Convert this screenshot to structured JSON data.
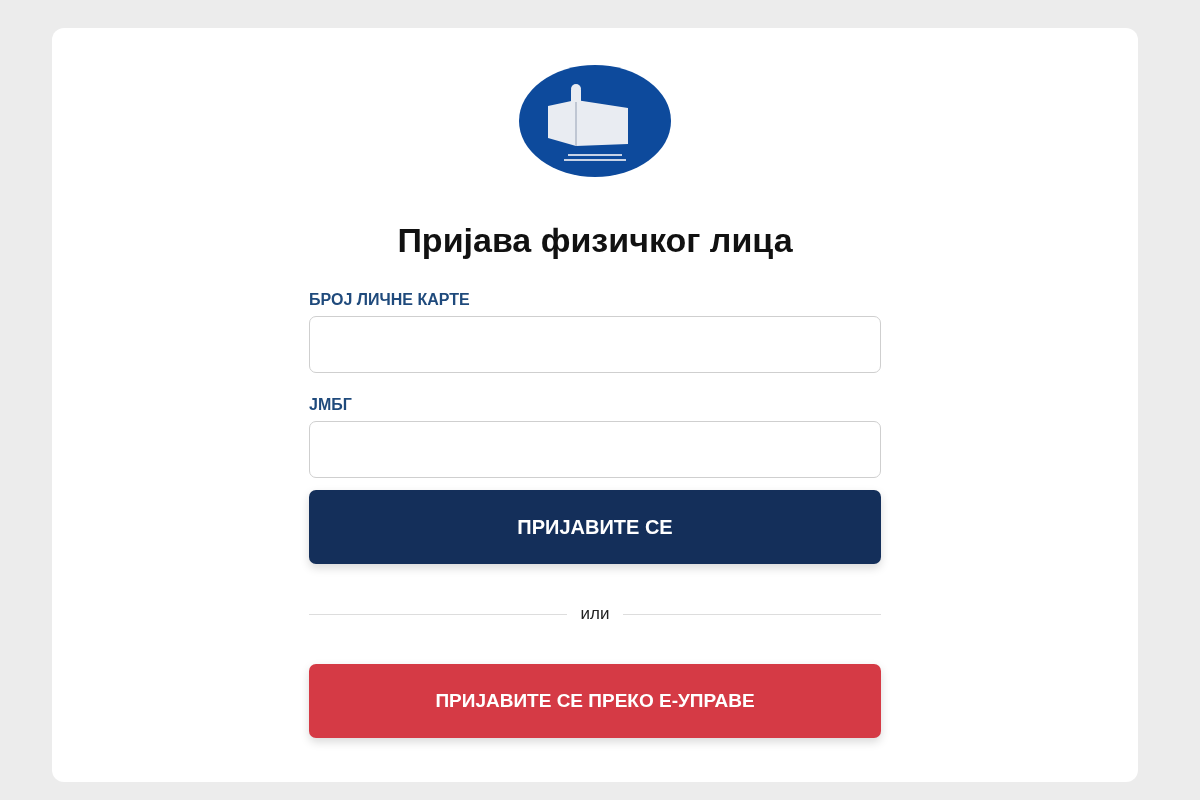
{
  "title": "Пријава физичког лица",
  "fields": [
    {
      "label": "БРОЈ ЛИЧНЕ КАРТЕ"
    },
    {
      "label": "ЈМБГ"
    }
  ],
  "buttons": [
    {
      "label": "ПРИЈАВИТЕ СЕ",
      "kind": "primary"
    },
    {
      "label": "ПРИЈАВИТЕ СЕ ПРЕКО Е-УПРАВЕ",
      "kind": "danger"
    }
  ],
  "separator": "или"
}
